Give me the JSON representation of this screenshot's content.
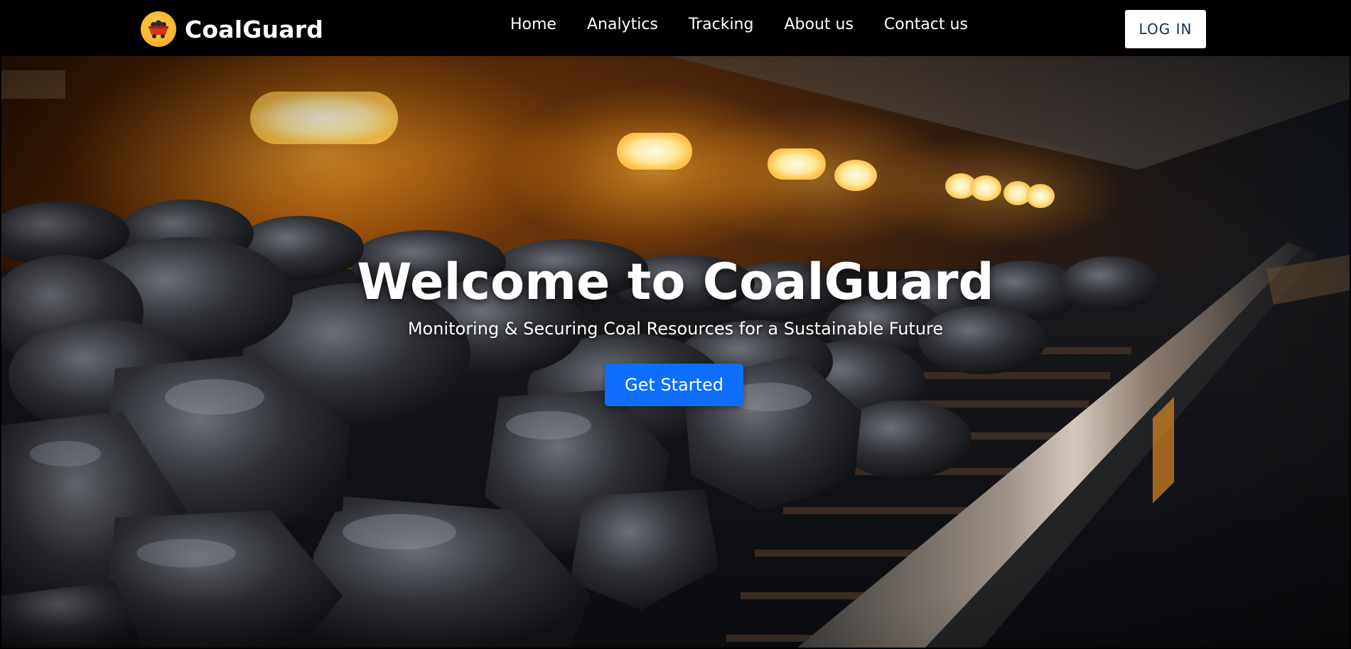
{
  "brand": {
    "name": "CoalGuard",
    "logo_icon": "mine-cart-icon",
    "logo_color": "#f5b22a"
  },
  "nav": {
    "items": [
      {
        "label": "Home"
      },
      {
        "label": "Analytics"
      },
      {
        "label": "Tracking"
      },
      {
        "label": "About us"
      },
      {
        "label": "Contact us"
      }
    ],
    "login_label": "LOG IN"
  },
  "hero": {
    "title": "Welcome to CoalGuard",
    "subtitle": "Monitoring & Securing Coal Resources for a Sustainable Future",
    "cta_label": "Get Started",
    "cta_color": "#0d6efd",
    "background": "coal-conveyor-photo"
  }
}
